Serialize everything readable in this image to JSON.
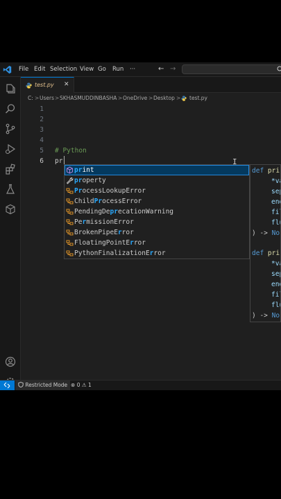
{
  "menu": {
    "file": "File",
    "edit": "Edit",
    "selection": "Selection",
    "view": "View",
    "go": "Go",
    "run": "Run",
    "more": "···"
  },
  "nav": {
    "back": "←",
    "forward": "→"
  },
  "tab": {
    "label": "test.py",
    "close": "✕"
  },
  "breadcrumb": {
    "items": [
      "C:",
      "Users",
      "SKHASMUDDINBASHA",
      "OneDrive",
      "Desktop",
      "test.py"
    ],
    "separator": ">"
  },
  "editor": {
    "line_numbers": [
      "1",
      "2",
      "3",
      "4",
      "5",
      "6"
    ],
    "comment_line": "# Python",
    "typed_text": "pr",
    "cursor_glyph": "I"
  },
  "suggestions": [
    {
      "pre": "",
      "hl": "pr",
      "post": "int",
      "icon": "cube-icon",
      "selected": true
    },
    {
      "pre": "",
      "hl": "pr",
      "post": "operty",
      "icon": "wrench-icon"
    },
    {
      "pre": "",
      "hl": "Pr",
      "post": "ocessLookupError",
      "icon": "class-icon"
    },
    {
      "pre": "Child",
      "hl": "Pr",
      "post": "ocessError",
      "icon": "class-icon"
    },
    {
      "pre": "PendingDe",
      "hl": "pr",
      "post": "ecationWarning",
      "icon": "class-icon"
    },
    {
      "pre": "Pe",
      "hl": "r",
      "post": "missionError",
      "icon": "class-icon"
    },
    {
      "pre": "BrokenPipeE",
      "hl": "r",
      "post": "ror",
      "icon": "class-icon"
    },
    {
      "pre": "FloatingPointE",
      "hl": "r",
      "post": "ror",
      "icon": "class-icon"
    },
    {
      "pre": "PythonFinalizationE",
      "hl": "r",
      "post": "ror",
      "icon": "class-icon"
    }
  ],
  "details": {
    "def_kw": "def",
    "fn_name": "pri",
    "params": [
      "*va",
      "sep",
      "end",
      "fil",
      "flu"
    ],
    "ret_arrow": ") ->",
    "ret_value": "No"
  },
  "status": {
    "restricted": "Restricted Mode",
    "errors": "0",
    "warnings": "1"
  },
  "colors": {
    "accent": "#0078d4",
    "highlight": "#2aaaff",
    "comment": "#6a9955",
    "tab_modified": "#e2c08d"
  }
}
